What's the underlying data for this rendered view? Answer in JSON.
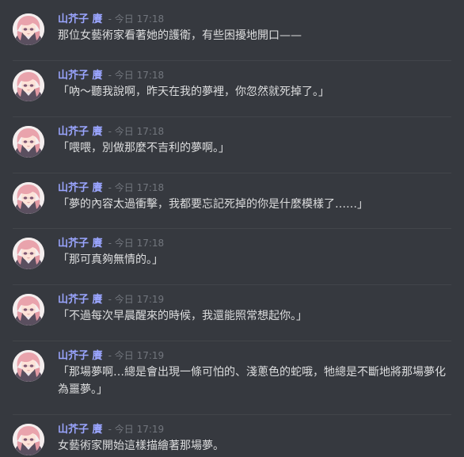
{
  "messages": [
    {
      "author": "山芥子 賡",
      "timestamp": "- 今日 17:18",
      "text": "那位女藝術家看著她的護衛，有些困擾地開口——"
    },
    {
      "author": "山芥子 賡",
      "timestamp": "- 今日 17:18",
      "text": "「吶～聽我說啊，昨天在我的夢裡，你忽然就死掉了。」"
    },
    {
      "author": "山芥子 賡",
      "timestamp": "- 今日 17:18",
      "text": "「喂喂，別做那麼不吉利的夢啊。」"
    },
    {
      "author": "山芥子 賡",
      "timestamp": "- 今日 17:18",
      "text": "「夢的內容太過衝擊，我都要忘記死掉的你是什麼模樣了……」"
    },
    {
      "author": "山芥子 賡",
      "timestamp": "- 今日 17:18",
      "text": "「那可真夠無情的。」"
    },
    {
      "author": "山芥子 賡",
      "timestamp": "- 今日 17:19",
      "text": "「不過每次早晨醒來的時候，我還能照常想起你。」"
    },
    {
      "author": "山芥子 賡",
      "timestamp": "- 今日 17:19",
      "text": "「那場夢啊…總是會出現一條可怕的、淺蔥色的蛇哦，牠總是不斷地將那場夢化為噩夢。」"
    },
    {
      "author": "山芥子 賡",
      "timestamp": "- 今日 17:19",
      "text": "女藝術家開始這樣描繪著那場夢。"
    }
  ],
  "colors": {
    "background": "#36393f",
    "username": "#9aa5ff",
    "timestamp": "#72767d",
    "text": "#dcddde",
    "divider": "#42454a"
  },
  "icons": {
    "avatar": "avatar-icon"
  }
}
